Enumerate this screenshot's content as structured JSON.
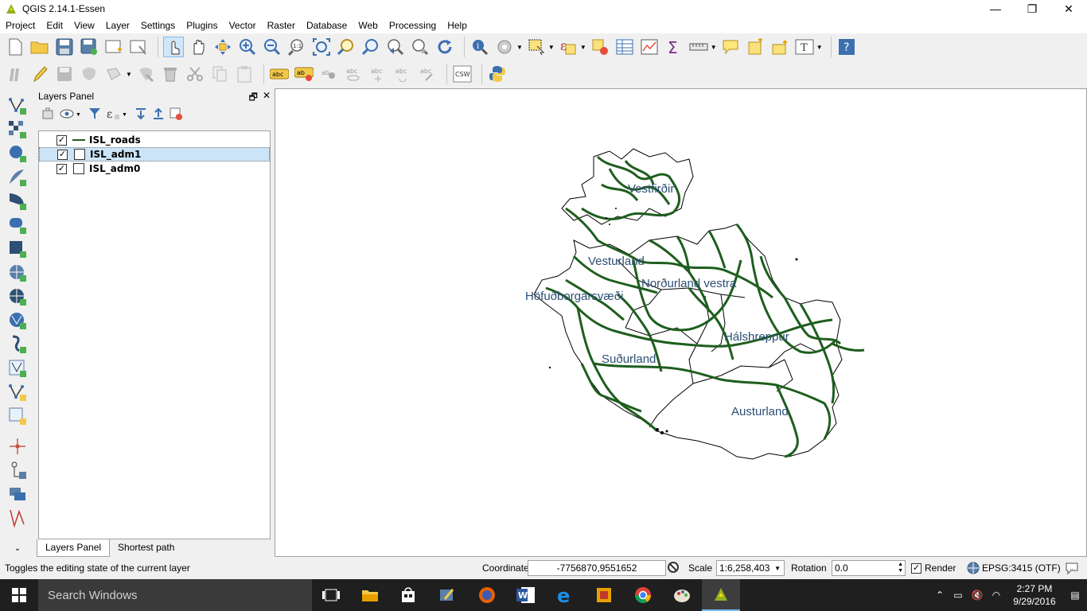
{
  "window": {
    "title": "QGIS 2.14.1-Essen",
    "controls": [
      "—",
      "❐",
      "✕"
    ]
  },
  "menu": [
    "Project",
    "Edit",
    "View",
    "Layer",
    "Settings",
    "Plugins",
    "Vector",
    "Raster",
    "Database",
    "Web",
    "Processing",
    "Help"
  ],
  "layers_panel": {
    "title": "Layers Panel",
    "layers": [
      {
        "name": "ISL_roads",
        "checked": true,
        "symbol": "line",
        "color": "#1e5e1e"
      },
      {
        "name": "ISL_adm1",
        "checked": true,
        "symbol": "polygon",
        "selected": true
      },
      {
        "name": "ISL_adm0",
        "checked": true,
        "symbol": "polygon"
      }
    ],
    "tabs": [
      "Layers Panel",
      "Shortest path"
    ]
  },
  "map": {
    "labels": [
      "Vestfirðir",
      "Vesturland",
      "Norðurland vestra",
      "Höfuðborgarsvæði",
      "Hálshreppur",
      "Suðurland",
      "Austurland"
    ],
    "road_color": "#1e5e1e",
    "label_color": "#2b4f73"
  },
  "status": {
    "message": "Toggles the editing state of the current layer",
    "coordinate_label": "Coordinate",
    "coordinate_value": "-7756870,9551652",
    "scale_label": "Scale",
    "scale_value": "1:6,258,403",
    "rotation_label": "Rotation",
    "rotation_value": "0.0",
    "render_label": "Render",
    "crs": "EPSG:3415 (OTF)"
  },
  "taskbar": {
    "search_placeholder": "Search Windows",
    "time": "2:27 PM",
    "date": "9/29/2016"
  },
  "toolbar_labels": {
    "csw": "CSW"
  }
}
